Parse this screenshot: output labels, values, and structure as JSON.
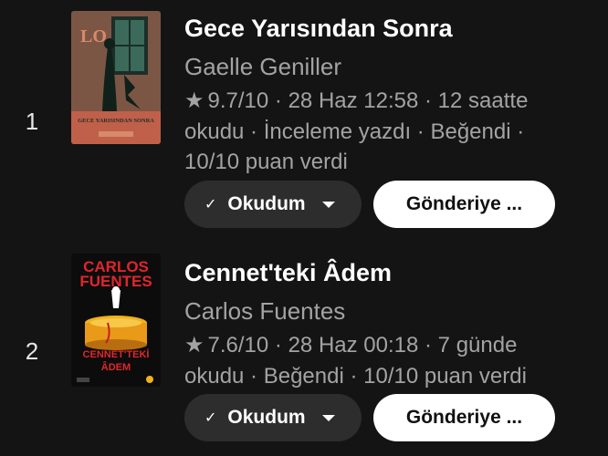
{
  "books": [
    {
      "rank": "1",
      "title": "Gece Yarısından Sonra",
      "author": "Gaelle Geniller",
      "rating": "9.7/10",
      "meta": " · 28 Haz 12:58 · 12 saatte okudu · İnceleme yazdı · Beğendi · 10/10 puan verdi",
      "status_label": "Okudum",
      "send_label": "Gönderiye ...",
      "cover": {
        "title_text": "GECE YARISINDAN SONRA",
        "top_text": "LO",
        "colors": [
          "#2b4a3f",
          "#c0604a",
          "#d88a6a",
          "#1c2e28"
        ]
      }
    },
    {
      "rank": "2",
      "title": "Cennet'teki Âdem",
      "author": "Carlos Fuentes",
      "rating": "7.6/10",
      "meta": " · 28 Haz 00:18 · 7 günde okudu · Beğendi · 10/10 puan verdi",
      "status_label": "Okudum",
      "send_label": "Gönderiye ...",
      "cover": {
        "author_line1": "CARLOS",
        "author_line2": "FUENTES",
        "title_line1": "CENNET'TEKİ",
        "title_line2": "ÂDEM",
        "colors": [
          "#0c0c0c",
          "#e0262b",
          "#f2b21c",
          "#ffffff"
        ]
      }
    }
  ]
}
